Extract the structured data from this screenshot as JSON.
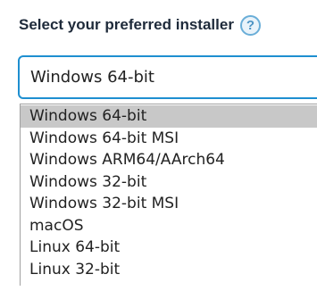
{
  "field": {
    "label": "Select your preferred installer",
    "help_icon": "question-mark-icon",
    "help_glyph": "?"
  },
  "select": {
    "value": "Windows 64-bit"
  },
  "dropdown": {
    "options": [
      "Windows 64-bit",
      "Windows 64-bit MSI",
      "Windows ARM64/AArch64",
      "Windows 32-bit",
      "Windows 32-bit MSI",
      "macOS",
      "Linux 64-bit",
      "Linux 32-bit"
    ],
    "highlighted": "Windows 64-bit"
  },
  "colors": {
    "label": "#1e2a3a",
    "focus_border": "#1e8fd0",
    "help_icon": "#6aaed8",
    "highlight": "#c8c8c8"
  }
}
